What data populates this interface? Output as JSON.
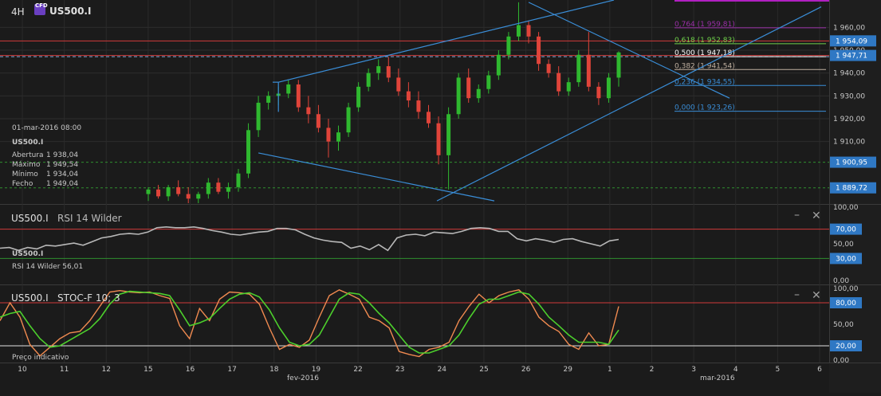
{
  "header": {
    "timeframe": "4H",
    "logo_text": "CFD",
    "symbol": "US500.I"
  },
  "info_box": {
    "datetime": "01-mar-2016 08:00",
    "symbol": "US500.I",
    "rows": [
      {
        "label": "Abertura",
        "value": "1 938,04"
      },
      {
        "label": "Máximo",
        "value": "1 949,54"
      },
      {
        "label": "Mínimo",
        "value": "1 934,04"
      },
      {
        "label": "Fecho",
        "value": "1 949,04"
      }
    ]
  },
  "rsi_panel": {
    "symbol": "US500.I",
    "indicator": "RSI 14 Wilder",
    "info_symbol": "US500.I",
    "info_value": "RSI 14 Wilder  56,01",
    "minimize": "–",
    "close": "✕"
  },
  "stoch_panel": {
    "symbol": "US500.I",
    "indicator": "STOC-F 10; 3",
    "minimize": "–",
    "close": "✕"
  },
  "footer": {
    "note": "Preço indicativo",
    "month_feb": "fev-2016",
    "month_mar": "mar-2016"
  },
  "chart_data": [
    {
      "type": "candlestick",
      "title": "US500.I 4H",
      "price_axis": {
        "ylim": [
          1883,
          1972
        ],
        "ticks": [
          "1 960,00",
          "1 950,00",
          "1 940,00",
          "1 930,00",
          "1 920,00",
          "1 910,00"
        ]
      },
      "price_tags": [
        {
          "label": "1 954,09",
          "value": 1954.09,
          "color": "#2f78c4"
        },
        {
          "label": "1 947,71",
          "value": 1947.71,
          "color": "#2f78c4"
        },
        {
          "label": "1 900,95",
          "value": 1900.95,
          "color": "#2f78c4"
        },
        {
          "label": "1 889,72",
          "value": 1889.72,
          "color": "#2f78c4"
        }
      ],
      "fibonacci": [
        {
          "label": "0,764 (1 959,81)",
          "value": 1959.81,
          "color": "#9b2fa8"
        },
        {
          "label": "0,618 (1 952,83)",
          "value": 1952.83,
          "color": "#6fd04a"
        },
        {
          "label": "0,500 (1 947,18)",
          "value": 1947.18,
          "color": "#ffffff"
        },
        {
          "label": "0,382 (1 941,54)",
          "value": 1941.54,
          "color": "#c0b0a0"
        },
        {
          "label": "0,236 (1 934,55)",
          "value": 1934.55,
          "color": "#3a8ed8"
        },
        {
          "label": "0,000 (1 923,26)",
          "value": 1923.26,
          "color": "#3a8ed8"
        }
      ],
      "x_labels": [
        "10",
        "11",
        "12",
        "15",
        "16",
        "17",
        "18",
        "19",
        "22",
        "23",
        "24",
        "25",
        "26",
        "29",
        "1",
        "2",
        "3",
        "4",
        "5",
        "6"
      ],
      "candles": [
        {
          "o": 1887,
          "h": 1890,
          "l": 1884,
          "c": 1889
        },
        {
          "o": 1889,
          "h": 1891,
          "l": 1885,
          "c": 1886
        },
        {
          "o": 1886,
          "h": 1891,
          "l": 1884,
          "c": 1890
        },
        {
          "o": 1890,
          "h": 1893,
          "l": 1886,
          "c": 1887
        },
        {
          "o": 1887,
          "h": 1890,
          "l": 1883,
          "c": 1885
        },
        {
          "o": 1885,
          "h": 1888,
          "l": 1883,
          "c": 1887
        },
        {
          "o": 1887,
          "h": 1894,
          "l": 1885,
          "c": 1892
        },
        {
          "o": 1892,
          "h": 1894,
          "l": 1887,
          "c": 1888
        },
        {
          "o": 1888,
          "h": 1892,
          "l": 1885,
          "c": 1890
        },
        {
          "o": 1890,
          "h": 1898,
          "l": 1888,
          "c": 1896
        },
        {
          "o": 1896,
          "h": 1918,
          "l": 1894,
          "c": 1915
        },
        {
          "o": 1915,
          "h": 1930,
          "l": 1912,
          "c": 1927
        },
        {
          "o": 1927,
          "h": 1932,
          "l": 1924,
          "c": 1930
        },
        {
          "o": 1930,
          "h": 1934,
          "l": 1926,
          "c": 1931
        },
        {
          "o": 1931,
          "h": 1937,
          "l": 1929,
          "c": 1935
        },
        {
          "o": 1935,
          "h": 1937,
          "l": 1923,
          "c": 1925
        },
        {
          "o": 1925,
          "h": 1930,
          "l": 1918,
          "c": 1922
        },
        {
          "o": 1922,
          "h": 1926,
          "l": 1914,
          "c": 1916
        },
        {
          "o": 1916,
          "h": 1920,
          "l": 1903,
          "c": 1910
        },
        {
          "o": 1910,
          "h": 1917,
          "l": 1906,
          "c": 1914
        },
        {
          "o": 1914,
          "h": 1927,
          "l": 1912,
          "c": 1925
        },
        {
          "o": 1925,
          "h": 1936,
          "l": 1923,
          "c": 1934
        },
        {
          "o": 1934,
          "h": 1942,
          "l": 1932,
          "c": 1940
        },
        {
          "o": 1940,
          "h": 1946,
          "l": 1937,
          "c": 1943
        },
        {
          "o": 1943,
          "h": 1947,
          "l": 1936,
          "c": 1938
        },
        {
          "o": 1938,
          "h": 1942,
          "l": 1930,
          "c": 1932
        },
        {
          "o": 1932,
          "h": 1936,
          "l": 1925,
          "c": 1928
        },
        {
          "o": 1928,
          "h": 1932,
          "l": 1920,
          "c": 1923
        },
        {
          "o": 1923,
          "h": 1926,
          "l": 1916,
          "c": 1918
        },
        {
          "o": 1918,
          "h": 1921,
          "l": 1900,
          "c": 1904
        },
        {
          "o": 1904,
          "h": 1925,
          "l": 1889,
          "c": 1922
        },
        {
          "o": 1922,
          "h": 1940,
          "l": 1920,
          "c": 1938
        },
        {
          "o": 1938,
          "h": 1942,
          "l": 1927,
          "c": 1929
        },
        {
          "o": 1929,
          "h": 1935,
          "l": 1927,
          "c": 1933
        },
        {
          "o": 1933,
          "h": 1941,
          "l": 1931,
          "c": 1939
        },
        {
          "o": 1939,
          "h": 1950,
          "l": 1937,
          "c": 1948
        },
        {
          "o": 1948,
          "h": 1958,
          "l": 1946,
          "c": 1956
        },
        {
          "o": 1956,
          "h": 1971,
          "l": 1954,
          "c": 1961
        },
        {
          "o": 1961,
          "h": 1963,
          "l": 1953,
          "c": 1956
        },
        {
          "o": 1956,
          "h": 1958,
          "l": 1941,
          "c": 1944
        },
        {
          "o": 1944,
          "h": 1946,
          "l": 1938,
          "c": 1940
        },
        {
          "o": 1940,
          "h": 1943,
          "l": 1930,
          "c": 1932
        },
        {
          "o": 1932,
          "h": 1938,
          "l": 1930,
          "c": 1936
        },
        {
          "o": 1936,
          "h": 1950,
          "l": 1934,
          "c": 1948
        },
        {
          "o": 1948,
          "h": 1958,
          "l": 1932,
          "c": 1934
        },
        {
          "o": 1934,
          "h": 1936,
          "l": 1926,
          "c": 1929
        },
        {
          "o": 1929,
          "h": 1940,
          "l": 1927,
          "c": 1938
        },
        {
          "o": 1938,
          "h": 1949.54,
          "l": 1934.04,
          "c": 1949.04
        }
      ]
    },
    {
      "type": "line",
      "title": "RSI 14 Wilder",
      "ylim": [
        0,
        100
      ],
      "ticks": [
        "100,00",
        "70,00",
        "50,00",
        "30,00",
        "0,00"
      ],
      "levels": [
        70,
        30
      ],
      "series": [
        {
          "name": "RSI 14 Wilder",
          "values": [
            44,
            45,
            41,
            45,
            43,
            48,
            47,
            49,
            51,
            48,
            53,
            58,
            60,
            63,
            64,
            63,
            66,
            72,
            73,
            72,
            72,
            73,
            71,
            68,
            66,
            63,
            62,
            64,
            66,
            67,
            71,
            71,
            69,
            63,
            58,
            55,
            53,
            52,
            44,
            47,
            42,
            49,
            41,
            58,
            62,
            63,
            61,
            66,
            65,
            64,
            67,
            71,
            72,
            71,
            67,
            67,
            57,
            54,
            57,
            55,
            52,
            56,
            57,
            53,
            50,
            47,
            54,
            56
          ]
        }
      ]
    },
    {
      "type": "line",
      "title": "STOC-F 10; 3",
      "ylim": [
        0,
        100
      ],
      "ticks": [
        "100,00",
        "80,00",
        "50,00",
        "20,00",
        "0,00"
      ],
      "levels": [
        80,
        20
      ],
      "series": [
        {
          "name": "%K",
          "values": [
            55,
            80,
            60,
            22,
            6,
            18,
            30,
            38,
            40,
            55,
            75,
            95,
            97,
            95,
            94,
            95,
            90,
            86,
            48,
            30,
            72,
            55,
            85,
            95,
            94,
            92,
            78,
            45,
            15,
            22,
            18,
            28,
            60,
            90,
            98,
            92,
            85,
            60,
            55,
            45,
            12,
            8,
            5,
            15,
            18,
            25,
            55,
            75,
            92,
            80,
            90,
            95,
            98,
            85,
            60,
            48,
            40,
            22,
            15,
            38,
            20,
            22,
            75
          ]
        },
        {
          "name": "%D",
          "values": [
            60,
            65,
            68,
            48,
            30,
            18,
            20,
            28,
            36,
            44,
            58,
            78,
            92,
            96,
            95,
            94,
            93,
            90,
            70,
            48,
            52,
            58,
            72,
            85,
            92,
            94,
            88,
            70,
            45,
            25,
            20,
            22,
            35,
            60,
            85,
            94,
            92,
            80,
            65,
            52,
            35,
            18,
            10,
            10,
            15,
            20,
            35,
            58,
            78,
            85,
            85,
            90,
            95,
            92,
            78,
            60,
            48,
            35,
            25,
            25,
            25,
            22,
            42
          ]
        }
      ]
    }
  ]
}
